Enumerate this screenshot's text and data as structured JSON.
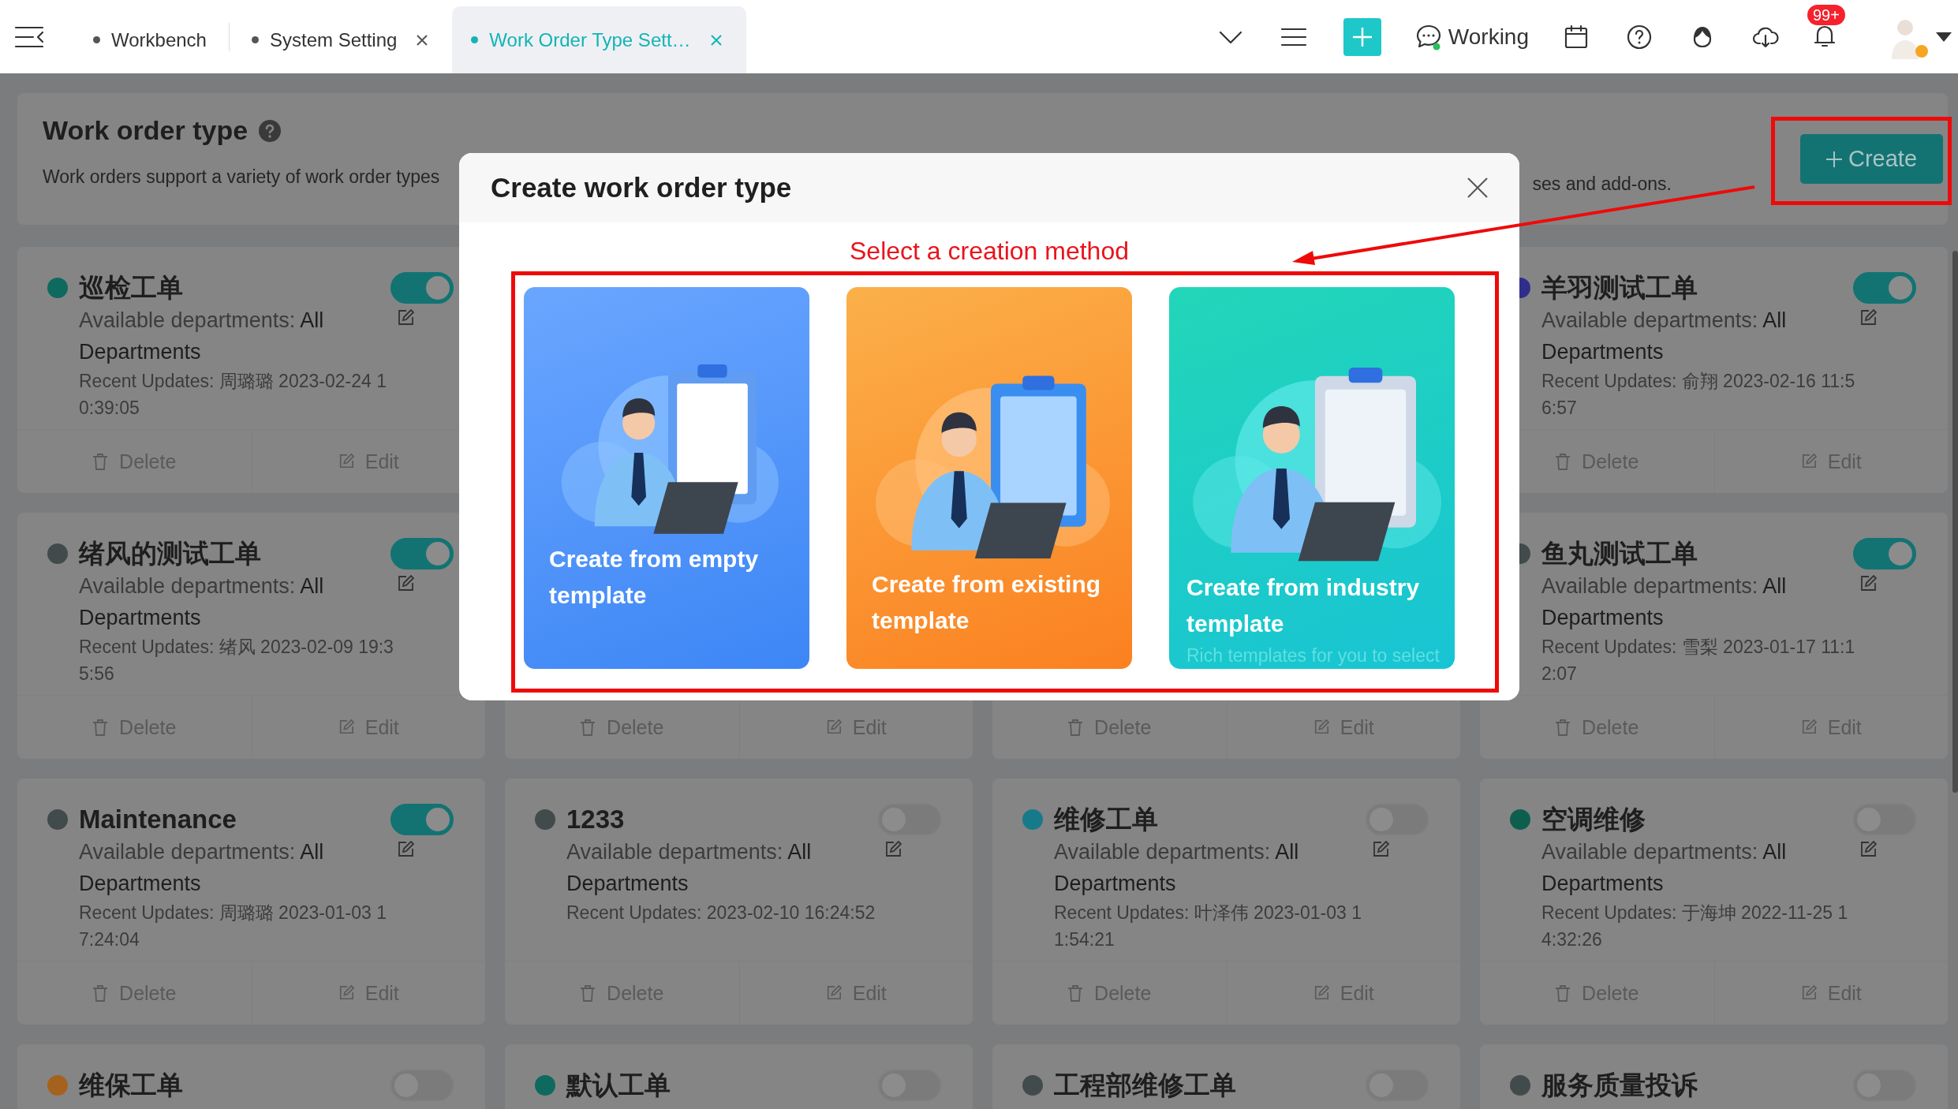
{
  "topbar": {
    "tabs": [
      {
        "label": "Workbench",
        "selected": false,
        "closable": false
      },
      {
        "label": "System Setting",
        "selected": false,
        "closable": true
      },
      {
        "label": "Work Order Type Sett…",
        "selected": true,
        "closable": true
      }
    ],
    "status": "Working",
    "notification_badge": "99+"
  },
  "header": {
    "title": "Work order type",
    "description_left": "Work orders support a variety of work order types",
    "description_right": "ses and add-ons.",
    "create_button": "Create"
  },
  "cards": [
    {
      "kind": "full",
      "title": "巡检工单",
      "color": "#0e6a5e",
      "enabled": true,
      "departments_label": "Available departments:",
      "departments_value": "All Departments",
      "recent_updates": "Recent Updates: 周璐璐 2023-02-24 10:39:05",
      "delete": "Delete",
      "edit": "Edit"
    },
    {
      "kind": "hidden"
    },
    {
      "kind": "hidden"
    },
    {
      "kind": "full",
      "title": "羊羽测试工单",
      "color": "#2e2f8c",
      "enabled": true,
      "departments_label": "Available departments:",
      "departments_value": "All Departments",
      "recent_updates": "Recent Updates: 俞翔 2023-02-16 11:56:57",
      "delete": "Delete",
      "edit": "Edit"
    },
    {
      "kind": "full",
      "title": "绪风的测试工单",
      "color": "#424b4b",
      "enabled": true,
      "departments_label": "Available departments:",
      "departments_value": "All Departments",
      "recent_updates": "Recent Updates: 绪风 2023-02-09 19:35:56",
      "delete": "Delete",
      "edit": "Edit"
    },
    {
      "kind": "footer",
      "delete": "Delete",
      "edit": "Edit"
    },
    {
      "kind": "footer",
      "delete": "Delete",
      "edit": "Edit"
    },
    {
      "kind": "full",
      "title": "鱼丸测试工单",
      "color": "#424b4b",
      "enabled": true,
      "departments_label": "Available departments:",
      "departments_value": "All Departments",
      "recent_updates": "Recent Updates: 雪梨 2023-01-17 11:12:07",
      "delete": "Delete",
      "edit": "Edit"
    },
    {
      "kind": "full",
      "title": "Maintenance",
      "color": "#424b4b",
      "enabled": true,
      "departments_label": "Available departments:",
      "departments_value": "All Departments",
      "recent_updates": "Recent Updates: 周璐璐 2023-01-03 17:24:04",
      "delete": "Delete",
      "edit": "Edit"
    },
    {
      "kind": "full",
      "title": "1233",
      "color": "#424b4b",
      "enabled": false,
      "departments_label": "Available departments:",
      "departments_value": "All Departments",
      "recent_updates": "Recent Updates: 2023-02-10 16:24:52",
      "delete": "Delete",
      "edit": "Edit"
    },
    {
      "kind": "full",
      "title": "维修工单",
      "color": "#177a8a",
      "enabled": false,
      "departments_label": "Available departments:",
      "departments_value": "All Departments",
      "recent_updates": "Recent Updates: 叶泽伟 2023-01-03 11:54:21",
      "delete": "Delete",
      "edit": "Edit"
    },
    {
      "kind": "full",
      "title": "空调维修",
      "color": "#0e5e50",
      "enabled": false,
      "departments_label": "Available departments:",
      "departments_value": "All Departments",
      "recent_updates": "Recent Updates: 于海坤 2022-11-25 14:32:26",
      "delete": "Delete",
      "edit": "Edit"
    },
    {
      "kind": "full",
      "title": "维保工单",
      "color": "#a5621e",
      "enabled": false
    },
    {
      "kind": "full",
      "title": "默认工单",
      "color": "#0e6a5e",
      "enabled": false
    },
    {
      "kind": "full",
      "title": "工程部维修工单",
      "color": "#424b4b",
      "enabled": false
    },
    {
      "kind": "full",
      "title": "服务质量投诉",
      "color": "#424b4b",
      "enabled": false
    }
  ],
  "modal": {
    "title": "Create work order type",
    "prompt": "Select a creation method",
    "options": [
      {
        "kind": "blue",
        "title": "Create from empty template"
      },
      {
        "kind": "orange",
        "title": "Create from existing template"
      },
      {
        "kind": "teal",
        "title": "Create from industry template",
        "subtitle": "Rich templates for you to select"
      }
    ]
  }
}
